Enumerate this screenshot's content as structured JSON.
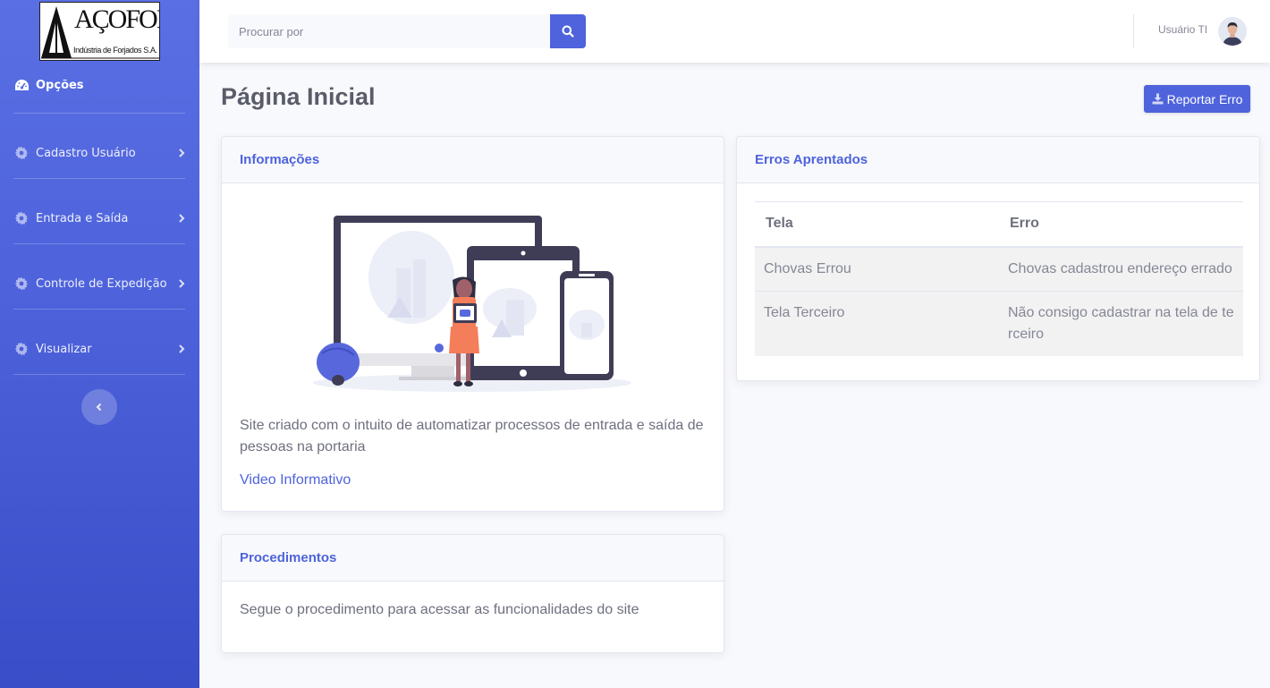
{
  "brand": {
    "logo_text": "AÇOFORJA",
    "logo_subtitle": "Indústria de Forjados S.A."
  },
  "sidebar": {
    "heading": "Opções",
    "items": [
      {
        "label": "Cadastro Usuário",
        "icon": "gear-icon"
      },
      {
        "label": "Entrada e Saída",
        "icon": "gear-icon"
      },
      {
        "label": "Controle de Expedição",
        "icon": "gear-icon"
      },
      {
        "label": "Visualizar",
        "icon": "gear-icon"
      }
    ]
  },
  "topbar": {
    "search_placeholder": "Procurar por",
    "user_name": "Usuário TI"
  },
  "page": {
    "title": "Página Inicial",
    "report_button": "Reportar Erro"
  },
  "info_card": {
    "title": "Informações",
    "text": "Site criado com o intuito de automatizar processos de entrada e saída de pessoas na portaria",
    "link": "Video Informativo"
  },
  "proc_card": {
    "title": "Procedimentos",
    "text": "Segue o procedimento para acessar as funcionalidades do site"
  },
  "errors_card": {
    "title": "Erros Aprentados",
    "columns": [
      "Tela",
      "Erro"
    ],
    "rows": [
      {
        "tela": "Chovas Errou",
        "erro": "Chovas cadastrou endereço errado"
      },
      {
        "tela": "Tela Terceiro",
        "erro": "Não consigo cadastrar na tela de te rceiro"
      }
    ]
  },
  "colors": {
    "primary": "#4e63dc",
    "sidebar_top": "#5a6fe3",
    "sidebar_bottom": "#3a4dc8",
    "background": "#f8f9fc"
  }
}
